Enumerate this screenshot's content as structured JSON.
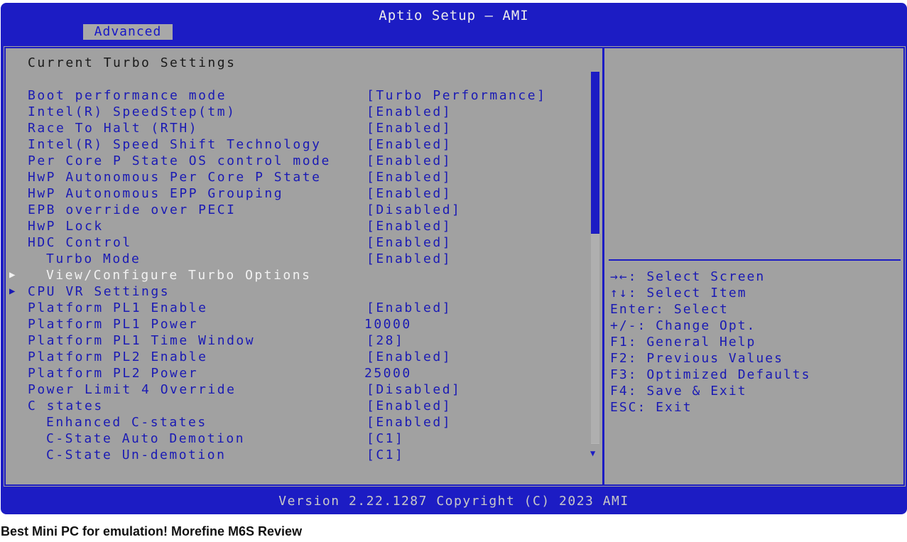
{
  "window": {
    "title": "Aptio Setup – AMI",
    "active_tab": "Advanced"
  },
  "section_title": "Current Turbo Settings",
  "settings": [
    {
      "label": "Boot performance mode",
      "value": "[Turbo Performance]"
    },
    {
      "label": "Intel(R) SpeedStep(tm)",
      "value": "[Enabled]"
    },
    {
      "label": "Race To Halt (RTH)",
      "value": "[Enabled]"
    },
    {
      "label": "Intel(R) Speed Shift Technology",
      "value": "[Enabled]"
    },
    {
      "label": "Per Core P State OS control mode",
      "value": "[Enabled]"
    },
    {
      "label": "HwP Autonomous Per Core P State",
      "value": "[Enabled]"
    },
    {
      "label": "HwP Autonomous EPP Grouping",
      "value": "[Enabled]"
    },
    {
      "label": "EPB override over PECI",
      "value": "[Disabled]"
    },
    {
      "label": "HwP Lock",
      "value": "[Enabled]"
    },
    {
      "label": "HDC Control",
      "value": "[Enabled]"
    },
    {
      "label": "Turbo Mode",
      "value": "[Enabled]"
    },
    {
      "label": "View/Configure Turbo Options",
      "value": ""
    },
    {
      "label": "CPU VR Settings",
      "value": ""
    },
    {
      "label": "Platform PL1 Enable",
      "value": "[Enabled]"
    },
    {
      "label": "Platform PL1 Power",
      "value": "10000"
    },
    {
      "label": "Platform PL1 Time Window",
      "value": "[28]"
    },
    {
      "label": "Platform PL2 Enable",
      "value": "[Enabled]"
    },
    {
      "label": "Platform PL2 Power",
      "value": "25000"
    },
    {
      "label": "Power Limit 4 Override",
      "value": "[Disabled]"
    },
    {
      "label": "C states",
      "value": "[Enabled]"
    },
    {
      "label": "Enhanced C-states",
      "value": "[Enabled]"
    },
    {
      "label": "C-State Auto Demotion",
      "value": "[C1]"
    },
    {
      "label": "C-State Un-demotion",
      "value": "[C1]"
    }
  ],
  "help": [
    "→←: Select Screen",
    "↑↓: Select Item",
    "Enter: Select",
    "+/-: Change Opt.",
    "F1: General Help",
    "F2: Previous Values",
    "F3: Optimized Defaults",
    "F4: Save & Exit",
    "ESC: Exit"
  ],
  "footer": "Version 2.22.1287 Copyright (C) 2023 AMI",
  "caption": "Best Mini PC for emulation! Morefine M6S Review",
  "colors": {
    "bios_blue": "#1c1cc4",
    "panel_gray": "#a1a1a1",
    "highlight_white": "#f2f2f2"
  }
}
